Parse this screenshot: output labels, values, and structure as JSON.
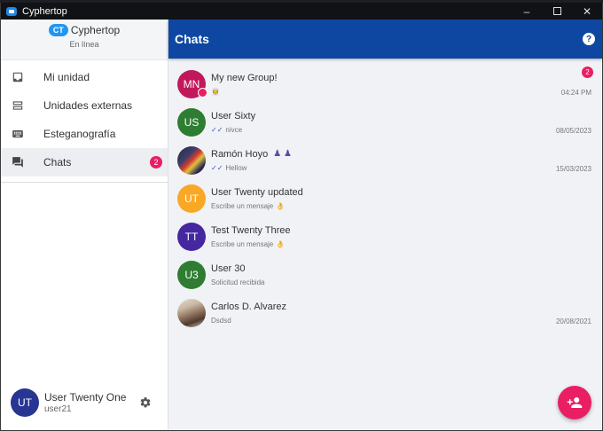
{
  "window": {
    "title": "Cyphertop"
  },
  "brand": {
    "name": "Cyphertop",
    "logo_text": "CT",
    "status": "En línea"
  },
  "nav": [
    {
      "label": "Mi unidad",
      "icon": "inbox-icon"
    },
    {
      "label": "Unidades externas",
      "icon": "drives-icon"
    },
    {
      "label": "Esteganografía",
      "icon": "keyboard-icon"
    },
    {
      "label": "Chats",
      "icon": "chat-icon",
      "badge": "2",
      "active": true
    }
  ],
  "user": {
    "initials": "UT",
    "name": "User Twenty One",
    "handle": "user21"
  },
  "header": {
    "title": "Chats",
    "help": "?"
  },
  "chats": [
    {
      "initials": "MN",
      "color": "#c2185b",
      "name": "My new Group!",
      "preview": "",
      "preview_emoji": "👳",
      "time": "04:24 PM",
      "badge": "2"
    },
    {
      "initials": "US",
      "color": "#2e7d32",
      "name": "User Sixty",
      "preview": "nivce",
      "ticks": "✓✓",
      "time": "08/05/2023"
    },
    {
      "initials": "",
      "name": "Ramón Hoyo",
      "name_emoji": "♟ ♟",
      "preview": "Hellow",
      "ticks": "✓✓",
      "time": "15/03/2023"
    },
    {
      "initials": "UT",
      "color": "#f9a825",
      "name": "User Twenty updated",
      "preview": "Escribe un mensaje",
      "preview_emoji": "👌",
      "time": ""
    },
    {
      "initials": "TT",
      "color": "#4527a0",
      "name": "Test Twenty Three",
      "preview": "Escribe un mensaje",
      "preview_emoji": "👌",
      "time": ""
    },
    {
      "initials": "U3",
      "color": "#2e7d32",
      "name": "User 30",
      "preview": "Solicitud recibida",
      "time": ""
    },
    {
      "initials": "",
      "name": "Carlos D. Alvarez",
      "preview": "Dsdsd",
      "time": "20/08/2021"
    }
  ],
  "colors": {
    "appbar": "#0d47a1",
    "accent": "#e91e63"
  },
  "fab": {
    "icon": "add-person-icon"
  }
}
